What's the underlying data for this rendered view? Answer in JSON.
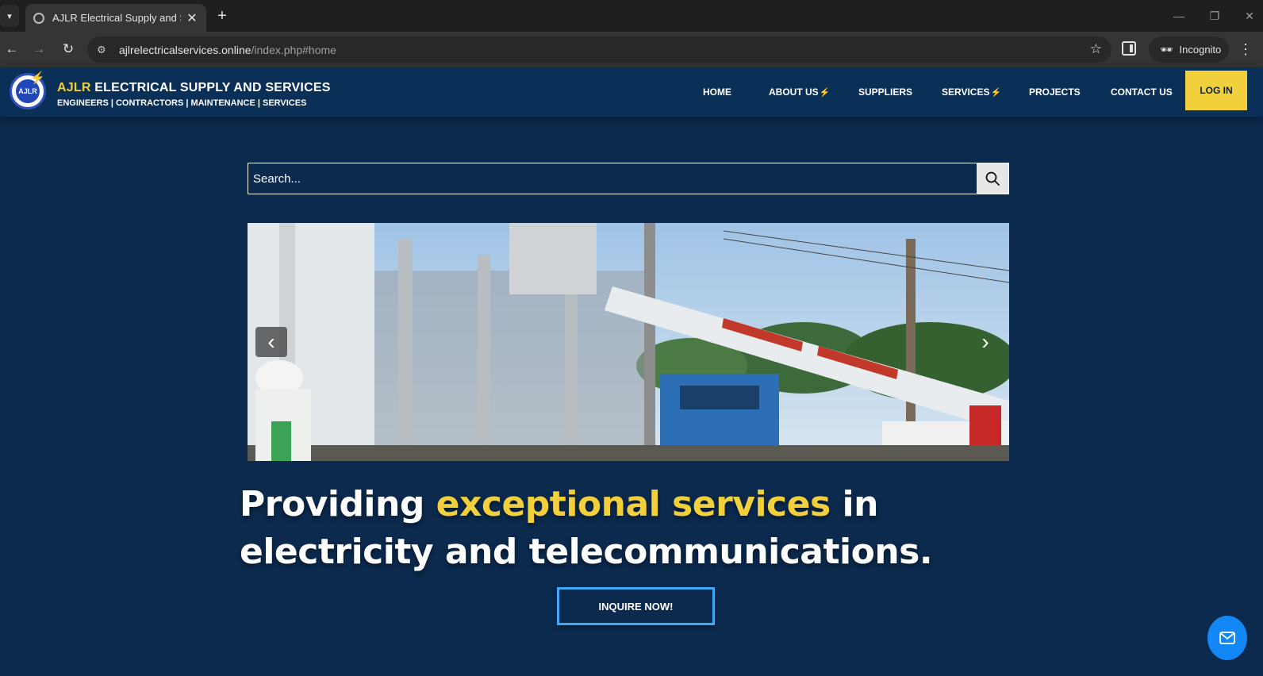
{
  "browser": {
    "tab_title": "AJLR Electrical Supply and Servi",
    "tab_close": "✕",
    "new_tab": "+",
    "url_domain": "ajlrelectricalservices.online",
    "url_path": "/index.php#home",
    "incognito_label": "Incognito"
  },
  "site": {
    "brand_accent": "AJLR",
    "brand_rest": " ELECTRICAL SUPPLY AND SERVICES",
    "tagline": "ENGINEERS | CONTRACTORS | MAINTENANCE | SERVICES",
    "logo_text": "AJLR",
    "nav": {
      "home": "HOME",
      "about": "ABOUT US",
      "suppliers": "SUPPLIERS",
      "services": "SERVICES",
      "projects": "PROJECTS",
      "contact": "CONTACT US",
      "login": "LOG IN"
    }
  },
  "search": {
    "placeholder": "Search..."
  },
  "carousel": {
    "prev": "‹",
    "next": "›"
  },
  "hero": {
    "part1": "Providing ",
    "accent": "exceptional services",
    "part2": " in electricity and telecommunications."
  },
  "cta": {
    "inquire": "INQUIRE NOW!"
  },
  "colors": {
    "accent": "#f2d03b",
    "header_bg": "#0b3057",
    "page_bg": "#0b2a4e",
    "fab": "#1287f5"
  }
}
